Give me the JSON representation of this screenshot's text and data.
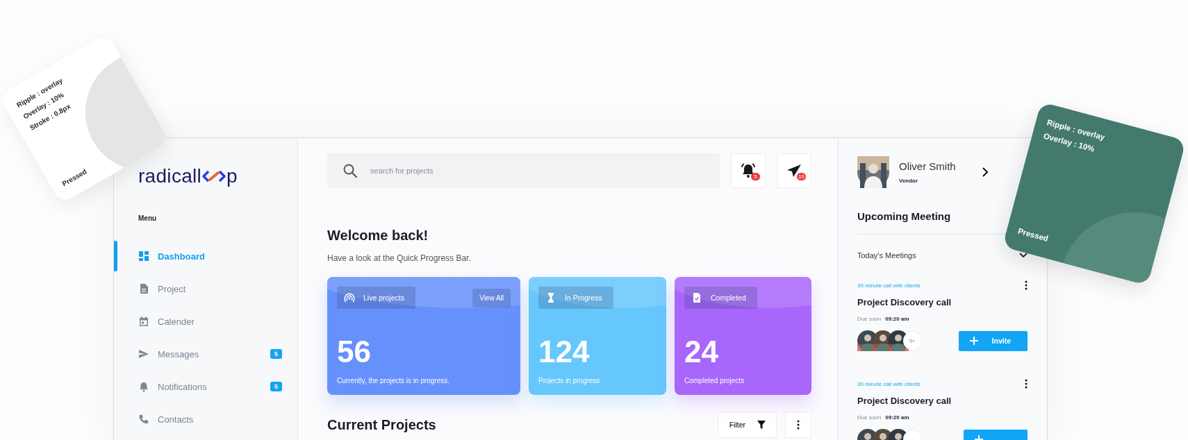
{
  "logo": {
    "text_before": "radicall",
    "text_after": "p"
  },
  "sidebar": {
    "menu_label": "Menu",
    "items": [
      {
        "label": "Dashboard",
        "selected": true
      },
      {
        "label": "Project",
        "selected": false
      },
      {
        "label": "Calender",
        "selected": false
      },
      {
        "label": "Messages",
        "selected": false,
        "badge": "5"
      },
      {
        "label": "Notifications",
        "selected": false,
        "badge": "5"
      },
      {
        "label": "Contacts",
        "selected": false
      }
    ]
  },
  "header": {
    "search": {
      "placeholder": "search for projects"
    },
    "buttons": [
      {
        "badge": "5"
      },
      {
        "badge": "10"
      }
    ]
  },
  "welcome": {
    "title": "Welcome back!",
    "subtitle": "Have a look at the Quick Progress Bar."
  },
  "stat_cards": [
    {
      "label": "Live projects",
      "action": "View All",
      "value": "56",
      "caption": "Currently, the projects is in progress.",
      "color": "#6690fc"
    },
    {
      "label": "In Progress",
      "value": "124",
      "caption": "Projects in progress",
      "color": "#66c7fc"
    },
    {
      "label": "Completed",
      "value": "24",
      "caption": "Completed projects",
      "color": "#a866fb"
    }
  ],
  "current_projects": {
    "title": "Current Projects",
    "filter": "Filter"
  },
  "profile": {
    "name": "Oliver Smith",
    "role": "Vendor"
  },
  "meetings": {
    "title": "Upcoming Meeting",
    "section": "Today's Meetings",
    "items": [
      {
        "caption": "30 minute call with clients",
        "title": "Project Discovery call",
        "due_label": "Due soon",
        "time": "09:20 am",
        "more_count": "5+",
        "action": "Invite"
      },
      {
        "caption": "30 minute call with clients",
        "title": "Project Discovery call",
        "due_label": "Due soon",
        "time": "09:20 am"
      }
    ]
  },
  "floating_cards": [
    {
      "kind": "light",
      "lines": [
        "Ripple : overlay",
        "Overlay : 10%",
        "Stroke : 0.8px"
      ],
      "state_label": "Pressed"
    },
    {
      "kind": "dark",
      "lines": [
        "Ripple : overlay",
        "Overlay : 10%"
      ],
      "state_label": "Pressed"
    }
  ]
}
